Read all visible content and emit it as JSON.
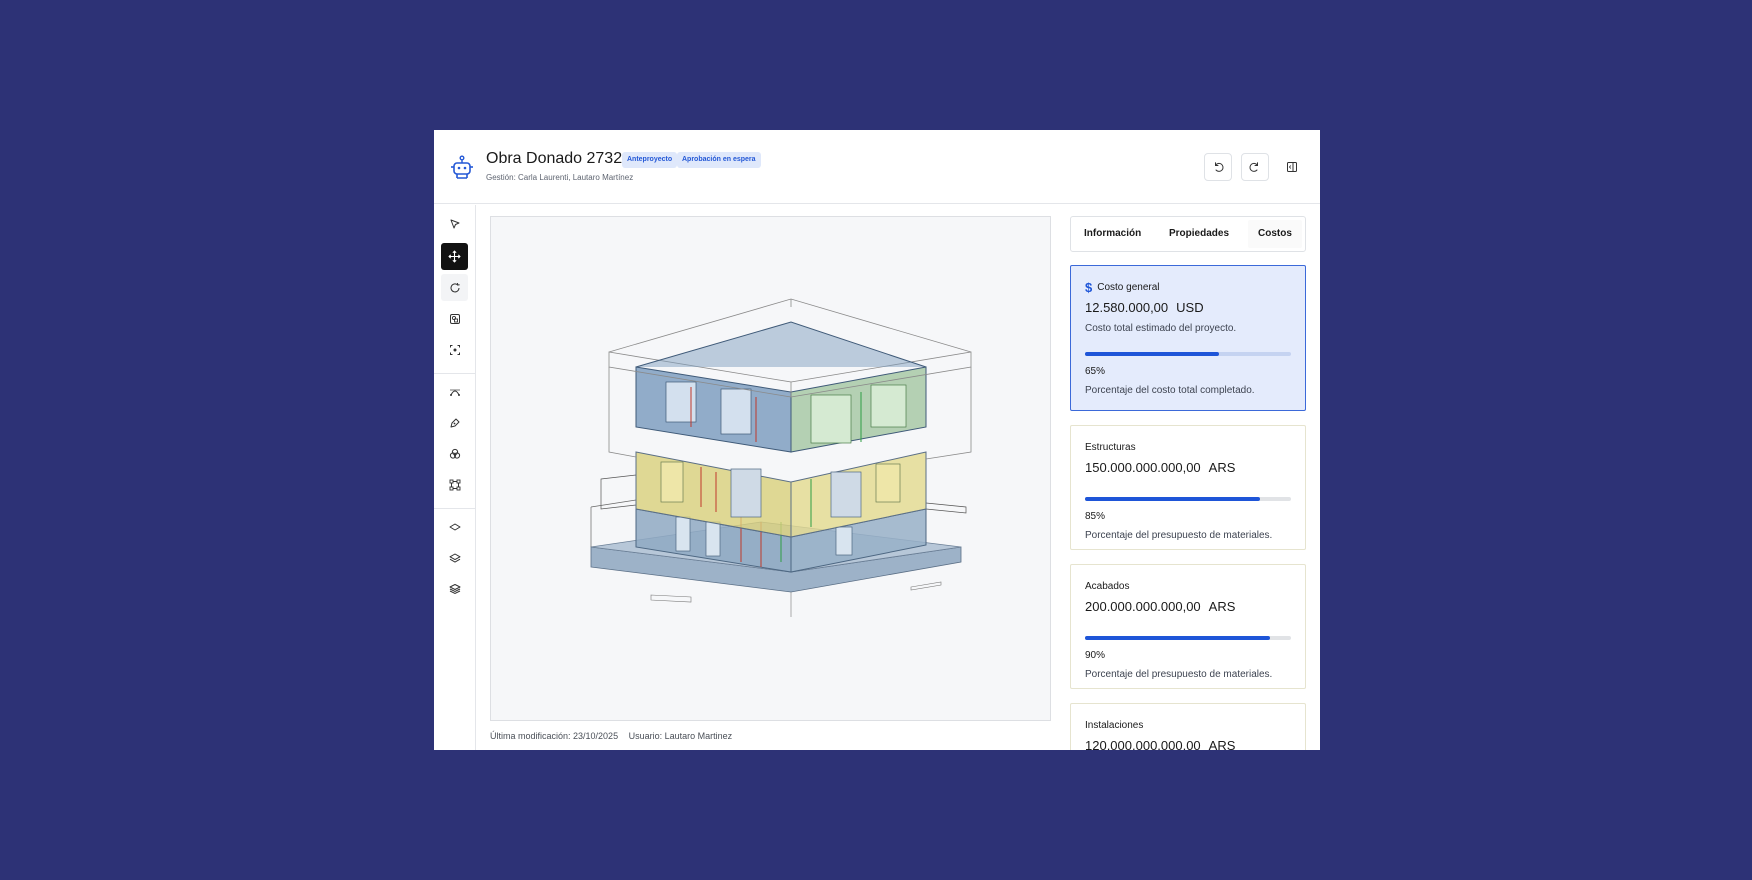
{
  "header": {
    "title": "Obra Donado 2732",
    "badges": [
      "Anteproyecto",
      "Aprobación en espera"
    ],
    "subtitle": "Gestión: Carla Laurenti, Lautaro Martínez",
    "undo_icon": "undo-icon",
    "redo_icon": "redo-icon",
    "panel_icon": "panel-toggle-icon"
  },
  "toolbar": {
    "tools": [
      "select-icon",
      "move-icon",
      "rotate-icon",
      "shapes-icon",
      "focus-icon",
      "curve-icon",
      "pen-icon",
      "union-icon",
      "frame-icon",
      "layer-single-icon",
      "layers-icon",
      "layers-stack-icon"
    ],
    "active": "move-icon"
  },
  "footer": {
    "modified": "Última modificación: 23/10/2025",
    "user": "Usuario: Lautaro Martinez"
  },
  "tabs": [
    "Información",
    "Propiedades",
    "Costos"
  ],
  "active_tab": "Costos",
  "costs": [
    {
      "title": "Costo general",
      "amount": "12.580.000,00",
      "currency": "USD",
      "description": "Costo total estimado del proyecto.",
      "percent": 65,
      "percent_label": "65%",
      "footnote": "Porcentaje del costo total completado."
    },
    {
      "title": "Estructuras",
      "amount": "150.000.000.000,00",
      "currency": "ARS",
      "percent": 85,
      "percent_label": "85%",
      "footnote": "Porcentaje del presupuesto de materiales."
    },
    {
      "title": "Acabados",
      "amount": "200.000.000.000,00",
      "currency": "ARS",
      "percent": 90,
      "percent_label": "90%",
      "footnote": "Porcentaje del presupuesto de materiales."
    },
    {
      "title": "Instalaciones",
      "amount": "120.000.000.000,00",
      "currency": "ARS"
    }
  ],
  "colors": {
    "background": "#2d3276",
    "accent": "#1e55d8",
    "highlight_card": "#e4ebfc"
  }
}
